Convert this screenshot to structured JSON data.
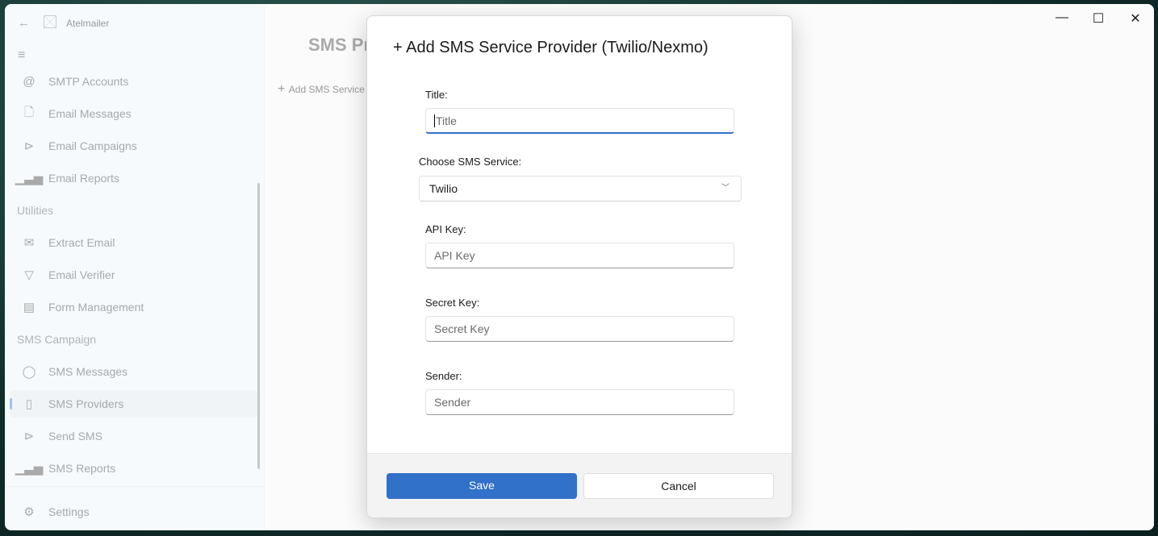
{
  "app": {
    "title": "Atelmailer"
  },
  "sidebar": {
    "items": [
      {
        "label": "SMTP Accounts",
        "icon": "at-icon",
        "glyph": "@"
      },
      {
        "label": "Email Messages",
        "icon": "document-icon",
        "glyph": "🗋"
      },
      {
        "label": "Email Campaigns",
        "icon": "send-icon",
        "glyph": "⊳"
      },
      {
        "label": "Email Reports",
        "icon": "signal-bars-icon",
        "glyph": "▁▃▅"
      },
      {
        "section": "Utilities"
      },
      {
        "label": "Extract Email",
        "icon": "mail-icon",
        "glyph": "✉"
      },
      {
        "label": "Email Verifier",
        "icon": "filter-icon",
        "glyph": "▽"
      },
      {
        "label": "Form Management",
        "icon": "form-icon",
        "glyph": "▤"
      },
      {
        "section": "SMS Campaign"
      },
      {
        "label": "SMS Messages",
        "icon": "chat-icon",
        "glyph": "◯"
      },
      {
        "label": "SMS Providers",
        "icon": "phone-icon",
        "glyph": "▯",
        "selected": true
      },
      {
        "label": "Send SMS",
        "icon": "send-icon",
        "glyph": "⊳"
      },
      {
        "label": "SMS Reports",
        "icon": "signal-bars-icon",
        "glyph": "▁▃▅"
      }
    ],
    "settings": "Settings"
  },
  "page": {
    "title": "SMS Providers",
    "add_label": "Add SMS Service Provider (Twilio/Nexmo)"
  },
  "dialog": {
    "title": "Add SMS Service Provider (Twilio/Nexmo)",
    "fields": {
      "title": {
        "label": "Title:",
        "placeholder": "Title",
        "value": ""
      },
      "service": {
        "label": "Choose SMS Service:",
        "value": "Twilio"
      },
      "api_key": {
        "label": "API Key:",
        "placeholder": "API Key",
        "value": ""
      },
      "secret_key": {
        "label": "Secret Key:",
        "placeholder": "Secret Key",
        "value": ""
      },
      "sender": {
        "label": "Sender:",
        "placeholder": "Sender",
        "value": ""
      }
    },
    "save": "Save",
    "cancel": "Cancel"
  },
  "colors": {
    "accent": "#3271c9"
  }
}
